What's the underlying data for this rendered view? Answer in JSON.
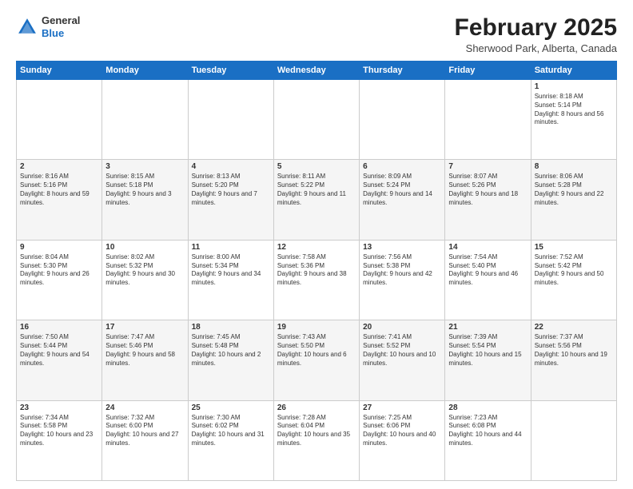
{
  "header": {
    "logo_general": "General",
    "logo_blue": "Blue",
    "month_title": "February 2025",
    "subtitle": "Sherwood Park, Alberta, Canada"
  },
  "days_of_week": [
    "Sunday",
    "Monday",
    "Tuesday",
    "Wednesday",
    "Thursday",
    "Friday",
    "Saturday"
  ],
  "weeks": [
    [
      {
        "day": "",
        "info": ""
      },
      {
        "day": "",
        "info": ""
      },
      {
        "day": "",
        "info": ""
      },
      {
        "day": "",
        "info": ""
      },
      {
        "day": "",
        "info": ""
      },
      {
        "day": "",
        "info": ""
      },
      {
        "day": "1",
        "info": "Sunrise: 8:18 AM\nSunset: 5:14 PM\nDaylight: 8 hours and 56 minutes."
      }
    ],
    [
      {
        "day": "2",
        "info": "Sunrise: 8:16 AM\nSunset: 5:16 PM\nDaylight: 8 hours and 59 minutes."
      },
      {
        "day": "3",
        "info": "Sunrise: 8:15 AM\nSunset: 5:18 PM\nDaylight: 9 hours and 3 minutes."
      },
      {
        "day": "4",
        "info": "Sunrise: 8:13 AM\nSunset: 5:20 PM\nDaylight: 9 hours and 7 minutes."
      },
      {
        "day": "5",
        "info": "Sunrise: 8:11 AM\nSunset: 5:22 PM\nDaylight: 9 hours and 11 minutes."
      },
      {
        "day": "6",
        "info": "Sunrise: 8:09 AM\nSunset: 5:24 PM\nDaylight: 9 hours and 14 minutes."
      },
      {
        "day": "7",
        "info": "Sunrise: 8:07 AM\nSunset: 5:26 PM\nDaylight: 9 hours and 18 minutes."
      },
      {
        "day": "8",
        "info": "Sunrise: 8:06 AM\nSunset: 5:28 PM\nDaylight: 9 hours and 22 minutes."
      }
    ],
    [
      {
        "day": "9",
        "info": "Sunrise: 8:04 AM\nSunset: 5:30 PM\nDaylight: 9 hours and 26 minutes."
      },
      {
        "day": "10",
        "info": "Sunrise: 8:02 AM\nSunset: 5:32 PM\nDaylight: 9 hours and 30 minutes."
      },
      {
        "day": "11",
        "info": "Sunrise: 8:00 AM\nSunset: 5:34 PM\nDaylight: 9 hours and 34 minutes."
      },
      {
        "day": "12",
        "info": "Sunrise: 7:58 AM\nSunset: 5:36 PM\nDaylight: 9 hours and 38 minutes."
      },
      {
        "day": "13",
        "info": "Sunrise: 7:56 AM\nSunset: 5:38 PM\nDaylight: 9 hours and 42 minutes."
      },
      {
        "day": "14",
        "info": "Sunrise: 7:54 AM\nSunset: 5:40 PM\nDaylight: 9 hours and 46 minutes."
      },
      {
        "day": "15",
        "info": "Sunrise: 7:52 AM\nSunset: 5:42 PM\nDaylight: 9 hours and 50 minutes."
      }
    ],
    [
      {
        "day": "16",
        "info": "Sunrise: 7:50 AM\nSunset: 5:44 PM\nDaylight: 9 hours and 54 minutes."
      },
      {
        "day": "17",
        "info": "Sunrise: 7:47 AM\nSunset: 5:46 PM\nDaylight: 9 hours and 58 minutes."
      },
      {
        "day": "18",
        "info": "Sunrise: 7:45 AM\nSunset: 5:48 PM\nDaylight: 10 hours and 2 minutes."
      },
      {
        "day": "19",
        "info": "Sunrise: 7:43 AM\nSunset: 5:50 PM\nDaylight: 10 hours and 6 minutes."
      },
      {
        "day": "20",
        "info": "Sunrise: 7:41 AM\nSunset: 5:52 PM\nDaylight: 10 hours and 10 minutes."
      },
      {
        "day": "21",
        "info": "Sunrise: 7:39 AM\nSunset: 5:54 PM\nDaylight: 10 hours and 15 minutes."
      },
      {
        "day": "22",
        "info": "Sunrise: 7:37 AM\nSunset: 5:56 PM\nDaylight: 10 hours and 19 minutes."
      }
    ],
    [
      {
        "day": "23",
        "info": "Sunrise: 7:34 AM\nSunset: 5:58 PM\nDaylight: 10 hours and 23 minutes."
      },
      {
        "day": "24",
        "info": "Sunrise: 7:32 AM\nSunset: 6:00 PM\nDaylight: 10 hours and 27 minutes."
      },
      {
        "day": "25",
        "info": "Sunrise: 7:30 AM\nSunset: 6:02 PM\nDaylight: 10 hours and 31 minutes."
      },
      {
        "day": "26",
        "info": "Sunrise: 7:28 AM\nSunset: 6:04 PM\nDaylight: 10 hours and 35 minutes."
      },
      {
        "day": "27",
        "info": "Sunrise: 7:25 AM\nSunset: 6:06 PM\nDaylight: 10 hours and 40 minutes."
      },
      {
        "day": "28",
        "info": "Sunrise: 7:23 AM\nSunset: 6:08 PM\nDaylight: 10 hours and 44 minutes."
      },
      {
        "day": "",
        "info": ""
      }
    ]
  ]
}
